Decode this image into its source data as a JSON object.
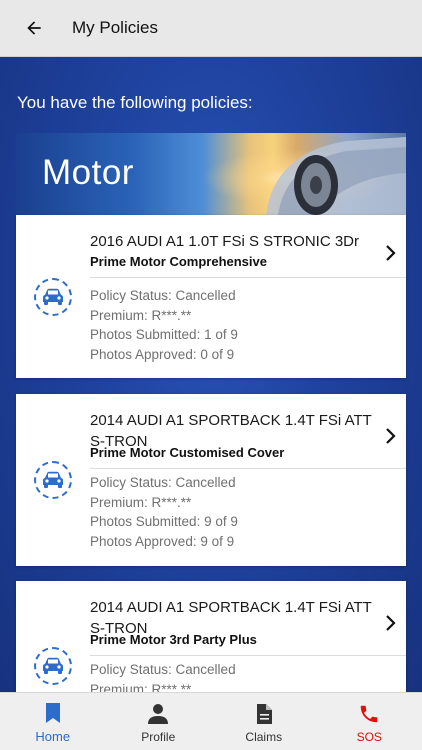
{
  "appbar": {
    "title": "My Policies",
    "back_icon": "arrow-back-icon"
  },
  "intro": "You have the following policies:",
  "banner": {
    "label": "Motor"
  },
  "policies": [
    {
      "vehicle": "2016 AUDI A1 1.0T FSi S STRONIC 3Dr",
      "plan": "Prime Motor Comprehensive",
      "status": "Policy Status: Cancelled",
      "premium": "Premium: R***.**",
      "photos_submitted": "Photos Submitted: 1 of 9",
      "photos_approved": "Photos Approved: 0 of 9"
    },
    {
      "vehicle": "2014 AUDI A1 SPORTBACK 1.4T FSi ATT S-TRON",
      "plan": "Prime Motor Customised Cover",
      "status": "Policy Status: Cancelled",
      "premium": "Premium: R***.**",
      "photos_submitted": "Photos Submitted: 9 of 9",
      "photos_approved": "Photos Approved: 9 of 9"
    },
    {
      "vehicle": "2014 AUDI A1 SPORTBACK 1.4T FSi ATT S-TRON",
      "plan": "Prime Motor 3rd Party Plus",
      "status": "Policy Status: Cancelled",
      "premium": "Premium: R***.**"
    }
  ],
  "bottom_nav": {
    "items": [
      {
        "label": "Home",
        "icon": "bookmark-icon"
      },
      {
        "label": "Profile",
        "icon": "person-icon"
      },
      {
        "label": "Claims",
        "icon": "document-icon"
      },
      {
        "label": "SOS",
        "icon": "phone-icon"
      }
    ]
  },
  "colors": {
    "accent": "#2d6ccb",
    "sos": "#e01010",
    "background": "#1f43a0"
  }
}
